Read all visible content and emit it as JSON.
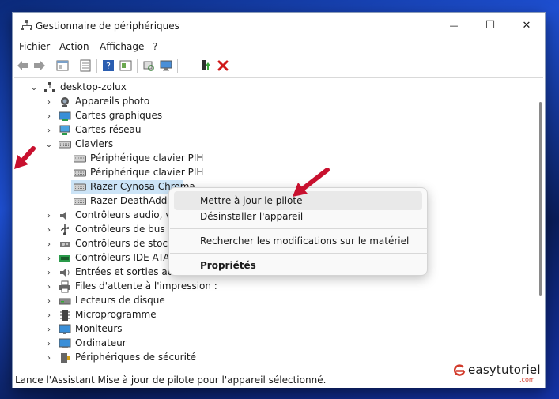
{
  "window": {
    "title": "Gestionnaire de périphériques",
    "minimize_glyph": "—",
    "maximize_glyph": "☐",
    "close_glyph": "✕"
  },
  "menu": [
    "Fichier",
    "Action",
    "Affichage",
    "?"
  ],
  "toolbar": {
    "icons": [
      "back-arrow-icon",
      "forward-arrow-icon",
      "properties-panel-icon",
      "device-list-icon",
      "help-icon",
      "view-icon",
      "scan-hardware-icon",
      "monitor-icon",
      "enable-device-icon",
      "uninstall-device-icon"
    ]
  },
  "tree": {
    "root": "desktop-zolux",
    "categories": [
      {
        "label": "Appareils photo",
        "icon": "camera-icon",
        "expanded": false
      },
      {
        "label": "Cartes graphiques",
        "icon": "display-adapter-icon",
        "expanded": false
      },
      {
        "label": "Cartes réseau",
        "icon": "network-adapter-icon",
        "expanded": false
      },
      {
        "label": "Claviers",
        "icon": "keyboard-icon",
        "expanded": true,
        "children": [
          "Périphérique clavier PIH",
          "Périphérique clavier PIH",
          "Razer Cynosa Chroma",
          "Razer DeathAdder Esse"
        ]
      },
      {
        "label": "Contrôleurs audio, vidéo e",
        "icon": "audio-icon",
        "expanded": false
      },
      {
        "label": "Contrôleurs de bus USB",
        "icon": "usb-icon",
        "expanded": false
      },
      {
        "label": "Contrôleurs de stockage",
        "icon": "storage-icon",
        "expanded": false
      },
      {
        "label": "Contrôleurs IDE ATA/ATAP",
        "icon": "ide-icon",
        "expanded": false
      },
      {
        "label": "Entrées et sorties audio",
        "icon": "speaker-icon",
        "expanded": false
      },
      {
        "label": "Files d'attente à l'impression :",
        "icon": "printer-icon",
        "expanded": false
      },
      {
        "label": "Lecteurs de disque",
        "icon": "disk-icon",
        "expanded": false
      },
      {
        "label": "Microprogramme",
        "icon": "firmware-icon",
        "expanded": false
      },
      {
        "label": "Moniteurs",
        "icon": "monitor-icon",
        "expanded": false
      },
      {
        "label": "Ordinateur",
        "icon": "computer-icon",
        "expanded": false
      },
      {
        "label": "Périphériques de sécurité",
        "icon": "security-icon",
        "expanded": false
      }
    ]
  },
  "context_menu": {
    "update": "Mettre à jour le pilote",
    "uninstall": "Désinstaller l'appareil",
    "scan": "Rechercher les modifications sur le matériel",
    "properties": "Propriétés"
  },
  "status": "Lance l'Assistant Mise à jour de pilote pour l'appareil sélectionné.",
  "watermark": {
    "text": "easytutoriel",
    "sub": ".com"
  },
  "colors": {
    "selection": "#cce4f7",
    "arrow": "#c8102e",
    "accent": "#0067c0"
  }
}
